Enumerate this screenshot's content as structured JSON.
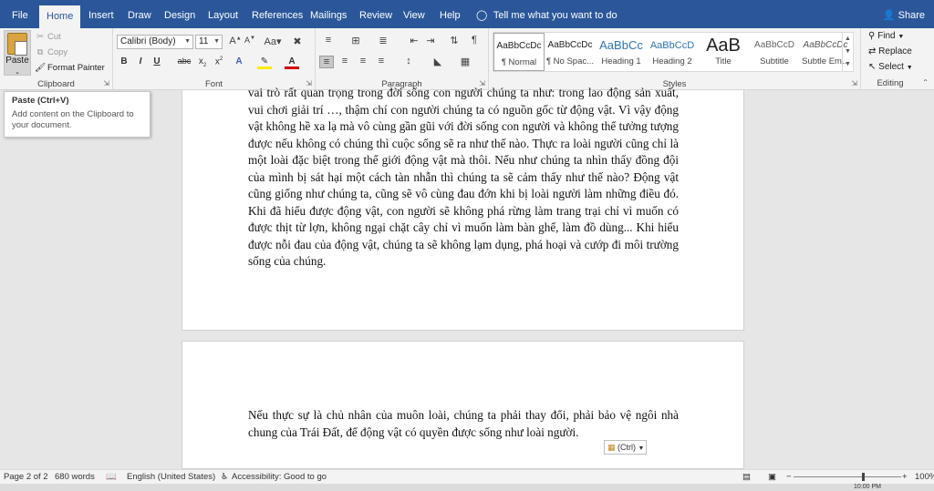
{
  "tabs": [
    "File",
    "Home",
    "Insert",
    "Draw",
    "Design",
    "Layout",
    "References",
    "Mailings",
    "Review",
    "View",
    "Help"
  ],
  "tell_me": "Tell me what you want to do",
  "share": "Share",
  "clipboard": {
    "paste": "Paste",
    "cut": "Cut",
    "copy": "Copy",
    "format_painter": "Format Painter",
    "label": "Clipboard"
  },
  "font": {
    "name": "Calibri (Body)",
    "size": "11",
    "label": "Font"
  },
  "paragraph": {
    "label": "Paragraph"
  },
  "styles": {
    "items": [
      {
        "sample": "AaBbCcDc",
        "name": "¶ Normal"
      },
      {
        "sample": "AaBbCcDc",
        "name": "¶ No Spac..."
      },
      {
        "sample": "AaBbCc",
        "name": "Heading 1"
      },
      {
        "sample": "AaBbCcD",
        "name": "Heading 2"
      },
      {
        "sample": "AaB",
        "name": "Title"
      },
      {
        "sample": "AaBbCcD",
        "name": "Subtitle"
      },
      {
        "sample": "AaBbCcDc",
        "name": "Subtle Em..."
      }
    ],
    "label": "Styles"
  },
  "editing": {
    "find": "Find",
    "replace": "Replace",
    "select": "Select",
    "label": "Editing"
  },
  "tooltip": {
    "title": "Paste (Ctrl+V)",
    "text": "Add content on the Clipboard to your document."
  },
  "document": {
    "page1_text": "vai trò rất quan trọng trong đời sống con người chúng ta như: trong lao động sản xuất, vui chơi giải trí …, thậm chí con người chúng ta có nguồn gốc từ động vật. Vì vậy động vật không hề xa lạ mà vô cùng gần gũi với đời sống con người và không thể tưởng tượng được nếu không có chúng thì cuộc sống sẽ ra như thế nào. Thực ra loài người cũng chỉ là một loài đặc biệt trong thế giới động vật mà thôi. Nếu như chúng ta nhìn thấy đồng đội của mình bị sát hại một cách tàn nhẫn thì chúng ta sẽ cảm thấy như thế nào? Động vật cũng giống như chúng ta, cũng sẽ vô cùng đau đớn khi bị loài người làm những điều đó. Khi đã hiểu được động vật, con người sẽ không phá rừng làm trang trại chỉ vì muốn có được thịt từ lợn, không ngại chặt cây chỉ vì muốn làm bàn ghế, làm đồ dùng... Khi hiểu được nỗi đau của động vật, chúng ta sẽ không lạm dụng, phá hoại và cướp đi môi trường sống của chúng.",
    "page2_text": "Nếu thực sự là chủ nhân của muôn loài, chúng ta phải thay đổi, phải bảo vệ ngôi nhà chung của Trái Đất, để động vật có quyền được sống như loài người.",
    "paste_options": "(Ctrl)"
  },
  "statusbar": {
    "page": "Page 2 of 2",
    "words": "680 words",
    "language": "English (United States)",
    "accessibility": "Accessibility: Good to go",
    "zoom": "100%"
  },
  "taskbar": {
    "time": "10:00 PM"
  },
  "colors": {
    "accent": "#2b579a",
    "ribbon": "#f3f3f3",
    "canvas": "#e6e6e6"
  }
}
